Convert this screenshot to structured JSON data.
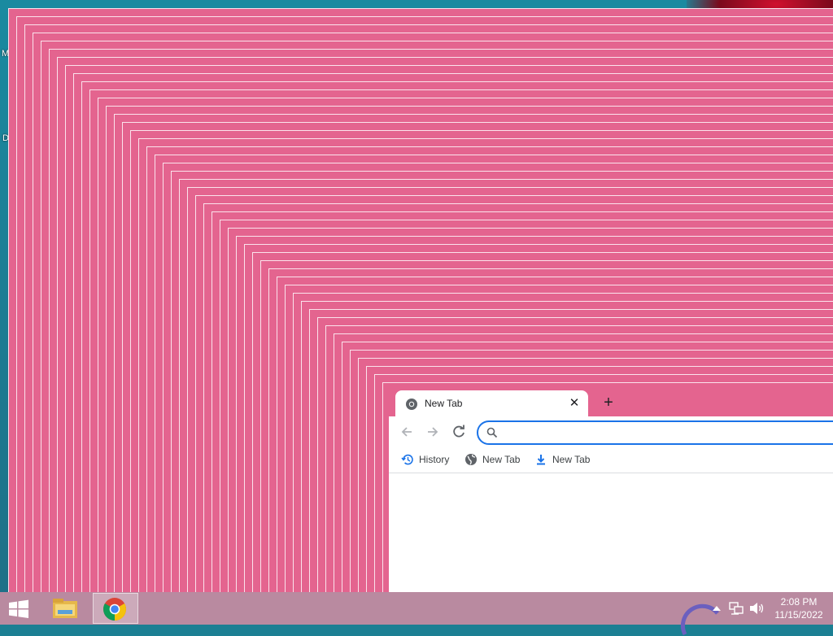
{
  "desktop": {
    "icon_label_m": "M",
    "icon_label_d": "D"
  },
  "browser": {
    "tab": {
      "title": "New Tab",
      "close_symbol": "✕"
    },
    "new_tab_symbol": "+",
    "omnibox": {
      "value": "",
      "placeholder": ""
    },
    "bookmarks": [
      {
        "label": "History",
        "icon": "history-icon"
      },
      {
        "label": "New Tab",
        "icon": "globe-icon"
      },
      {
        "label": "New Tab",
        "icon": "download-icon"
      }
    ]
  },
  "taskbar": {
    "apps": [
      "start-button",
      "file-explorer",
      "google-chrome"
    ],
    "clock_time": "2:08 PM",
    "clock_date": "11/15/2022"
  },
  "colors": {
    "ghost_window": "#e4648f",
    "desktop": "#1a8aa0",
    "taskbar": "#b98aa0",
    "accent": "#1a73e8"
  }
}
